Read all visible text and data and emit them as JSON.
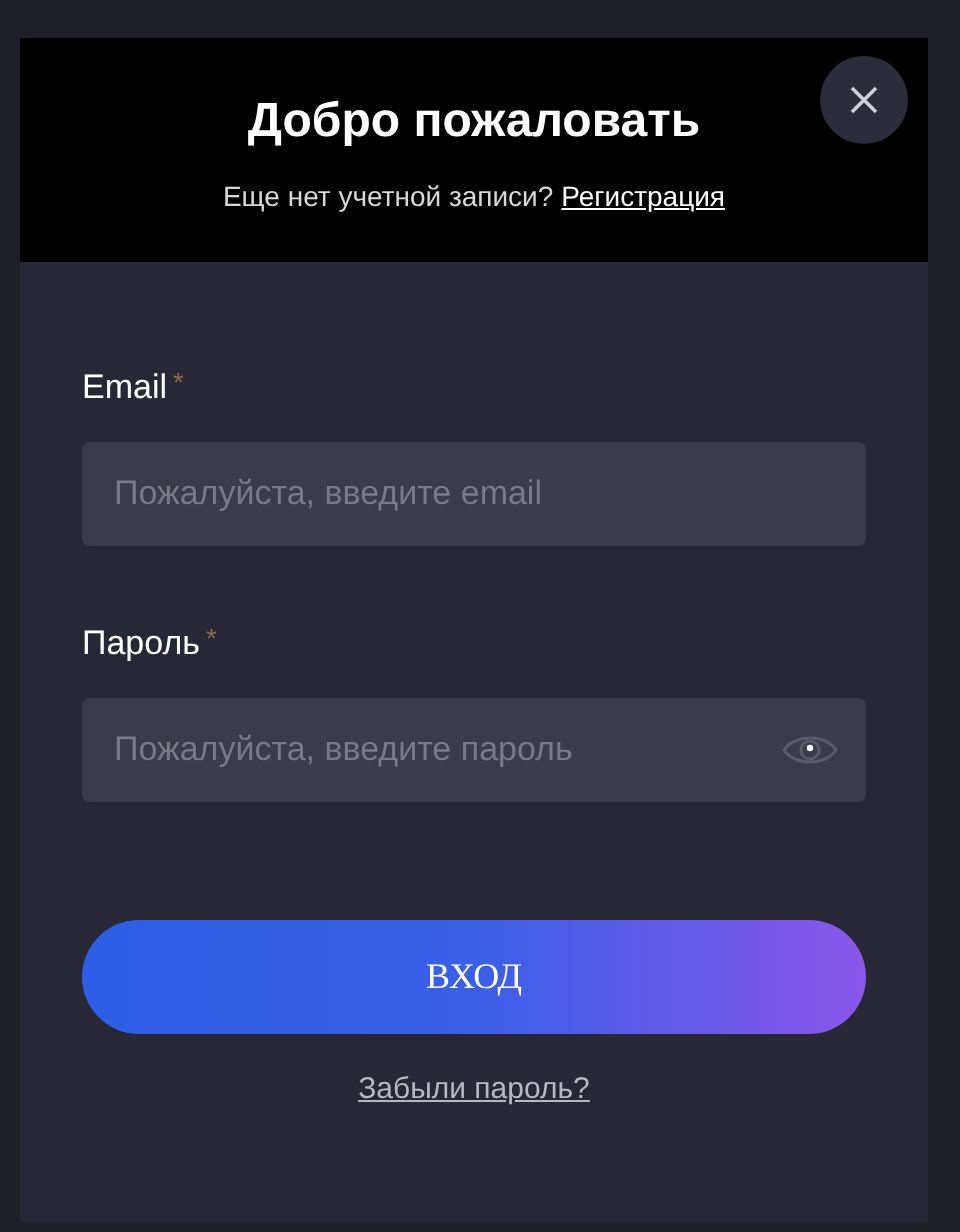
{
  "modal": {
    "title": "Добро пожаловать",
    "subtitle": "Еще нет учетной записи?",
    "register_link": "Регистрация"
  },
  "fields": [
    {
      "label": "Email",
      "required_mark": "*",
      "placeholder": "Пожалуйста, введите email",
      "kind": "text"
    },
    {
      "label": "Пароль",
      "required_mark": "*",
      "placeholder": "Пожалуйста, введите пароль",
      "kind": "password"
    }
  ],
  "submit_button": "ВХОД",
  "forgot_link": "Забыли пароль?"
}
